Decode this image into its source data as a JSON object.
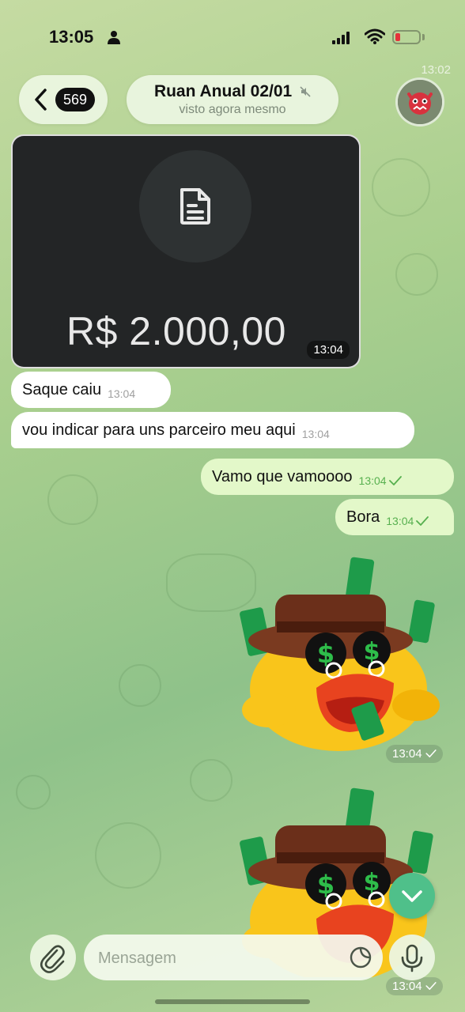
{
  "status_bar": {
    "time": "13:05"
  },
  "header": {
    "back_count": "569",
    "chat_title": "Ruan Anual 02/01",
    "chat_status": "visto agora mesmo",
    "top_time": "13:02"
  },
  "messages": [
    {
      "type": "media",
      "direction": "in",
      "text": "R$ 2.000,00",
      "time": "13:04"
    },
    {
      "type": "text",
      "direction": "in",
      "text": "Saque caiu",
      "time": "13:04"
    },
    {
      "type": "text",
      "direction": "in",
      "text": "vou indicar para uns parceiro meu aqui",
      "time": "13:04"
    },
    {
      "type": "text",
      "direction": "out",
      "text": "Vamo que vamoooo",
      "time": "13:04",
      "read": true
    },
    {
      "type": "text",
      "direction": "out",
      "text": "Bora",
      "time": "13:04",
      "read": true
    },
    {
      "type": "sticker",
      "direction": "out",
      "sticker": "money-duck",
      "time": "13:04",
      "read": true
    },
    {
      "type": "sticker",
      "direction": "out",
      "sticker": "money-duck",
      "time": "13:04",
      "read": true
    }
  ],
  "composer": {
    "placeholder": "Mensagem"
  },
  "colors": {
    "accent_green": "#4fc08a",
    "outgoing_bubble": "#e3f8c9",
    "incoming_bubble": "#ffffff",
    "battery_low": "#e5333b"
  },
  "icons": [
    "person-icon",
    "signal-icon",
    "wifi-icon",
    "battery-icon",
    "back-chevron-icon",
    "mute-icon",
    "document-icon",
    "check-icon",
    "chevron-down-icon",
    "paperclip-icon",
    "sticker-icon",
    "microphone-icon"
  ]
}
